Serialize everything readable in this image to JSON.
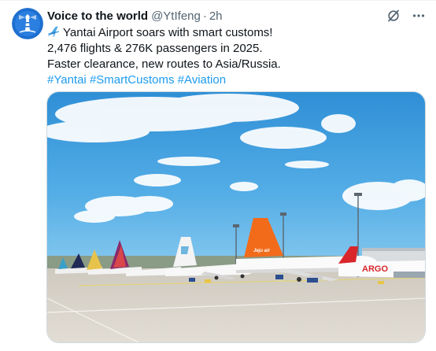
{
  "tweet": {
    "display_name": "Voice to the world",
    "handle": "@YtIfeng",
    "separator": "·",
    "timestamp": "2h",
    "avatar_icon": "lighthouse-icon",
    "lines": [
      "Yantai Airport soars with smart customs!",
      "2,476 flights & 276K passengers in 2025.",
      "Faster clearance, new routes to Asia/Russia."
    ],
    "leading_emoji": "airplane-icon",
    "hashtags": [
      "#Yantai",
      "#SmartCustoms",
      "#Aviation"
    ],
    "media": {
      "description_icons": [
        "aircraft",
        "sky",
        "apron"
      ],
      "visible_text": [
        "Jeju air",
        "ARGO"
      ]
    }
  },
  "icons": {
    "grok": "grok-icon",
    "more": "more-icon"
  },
  "colors": {
    "text": "#0f1419",
    "secondary": "#536471",
    "accent": "#1d9bf0",
    "border": "#cfd9de",
    "avatar_bg": "#1d6fcf"
  }
}
